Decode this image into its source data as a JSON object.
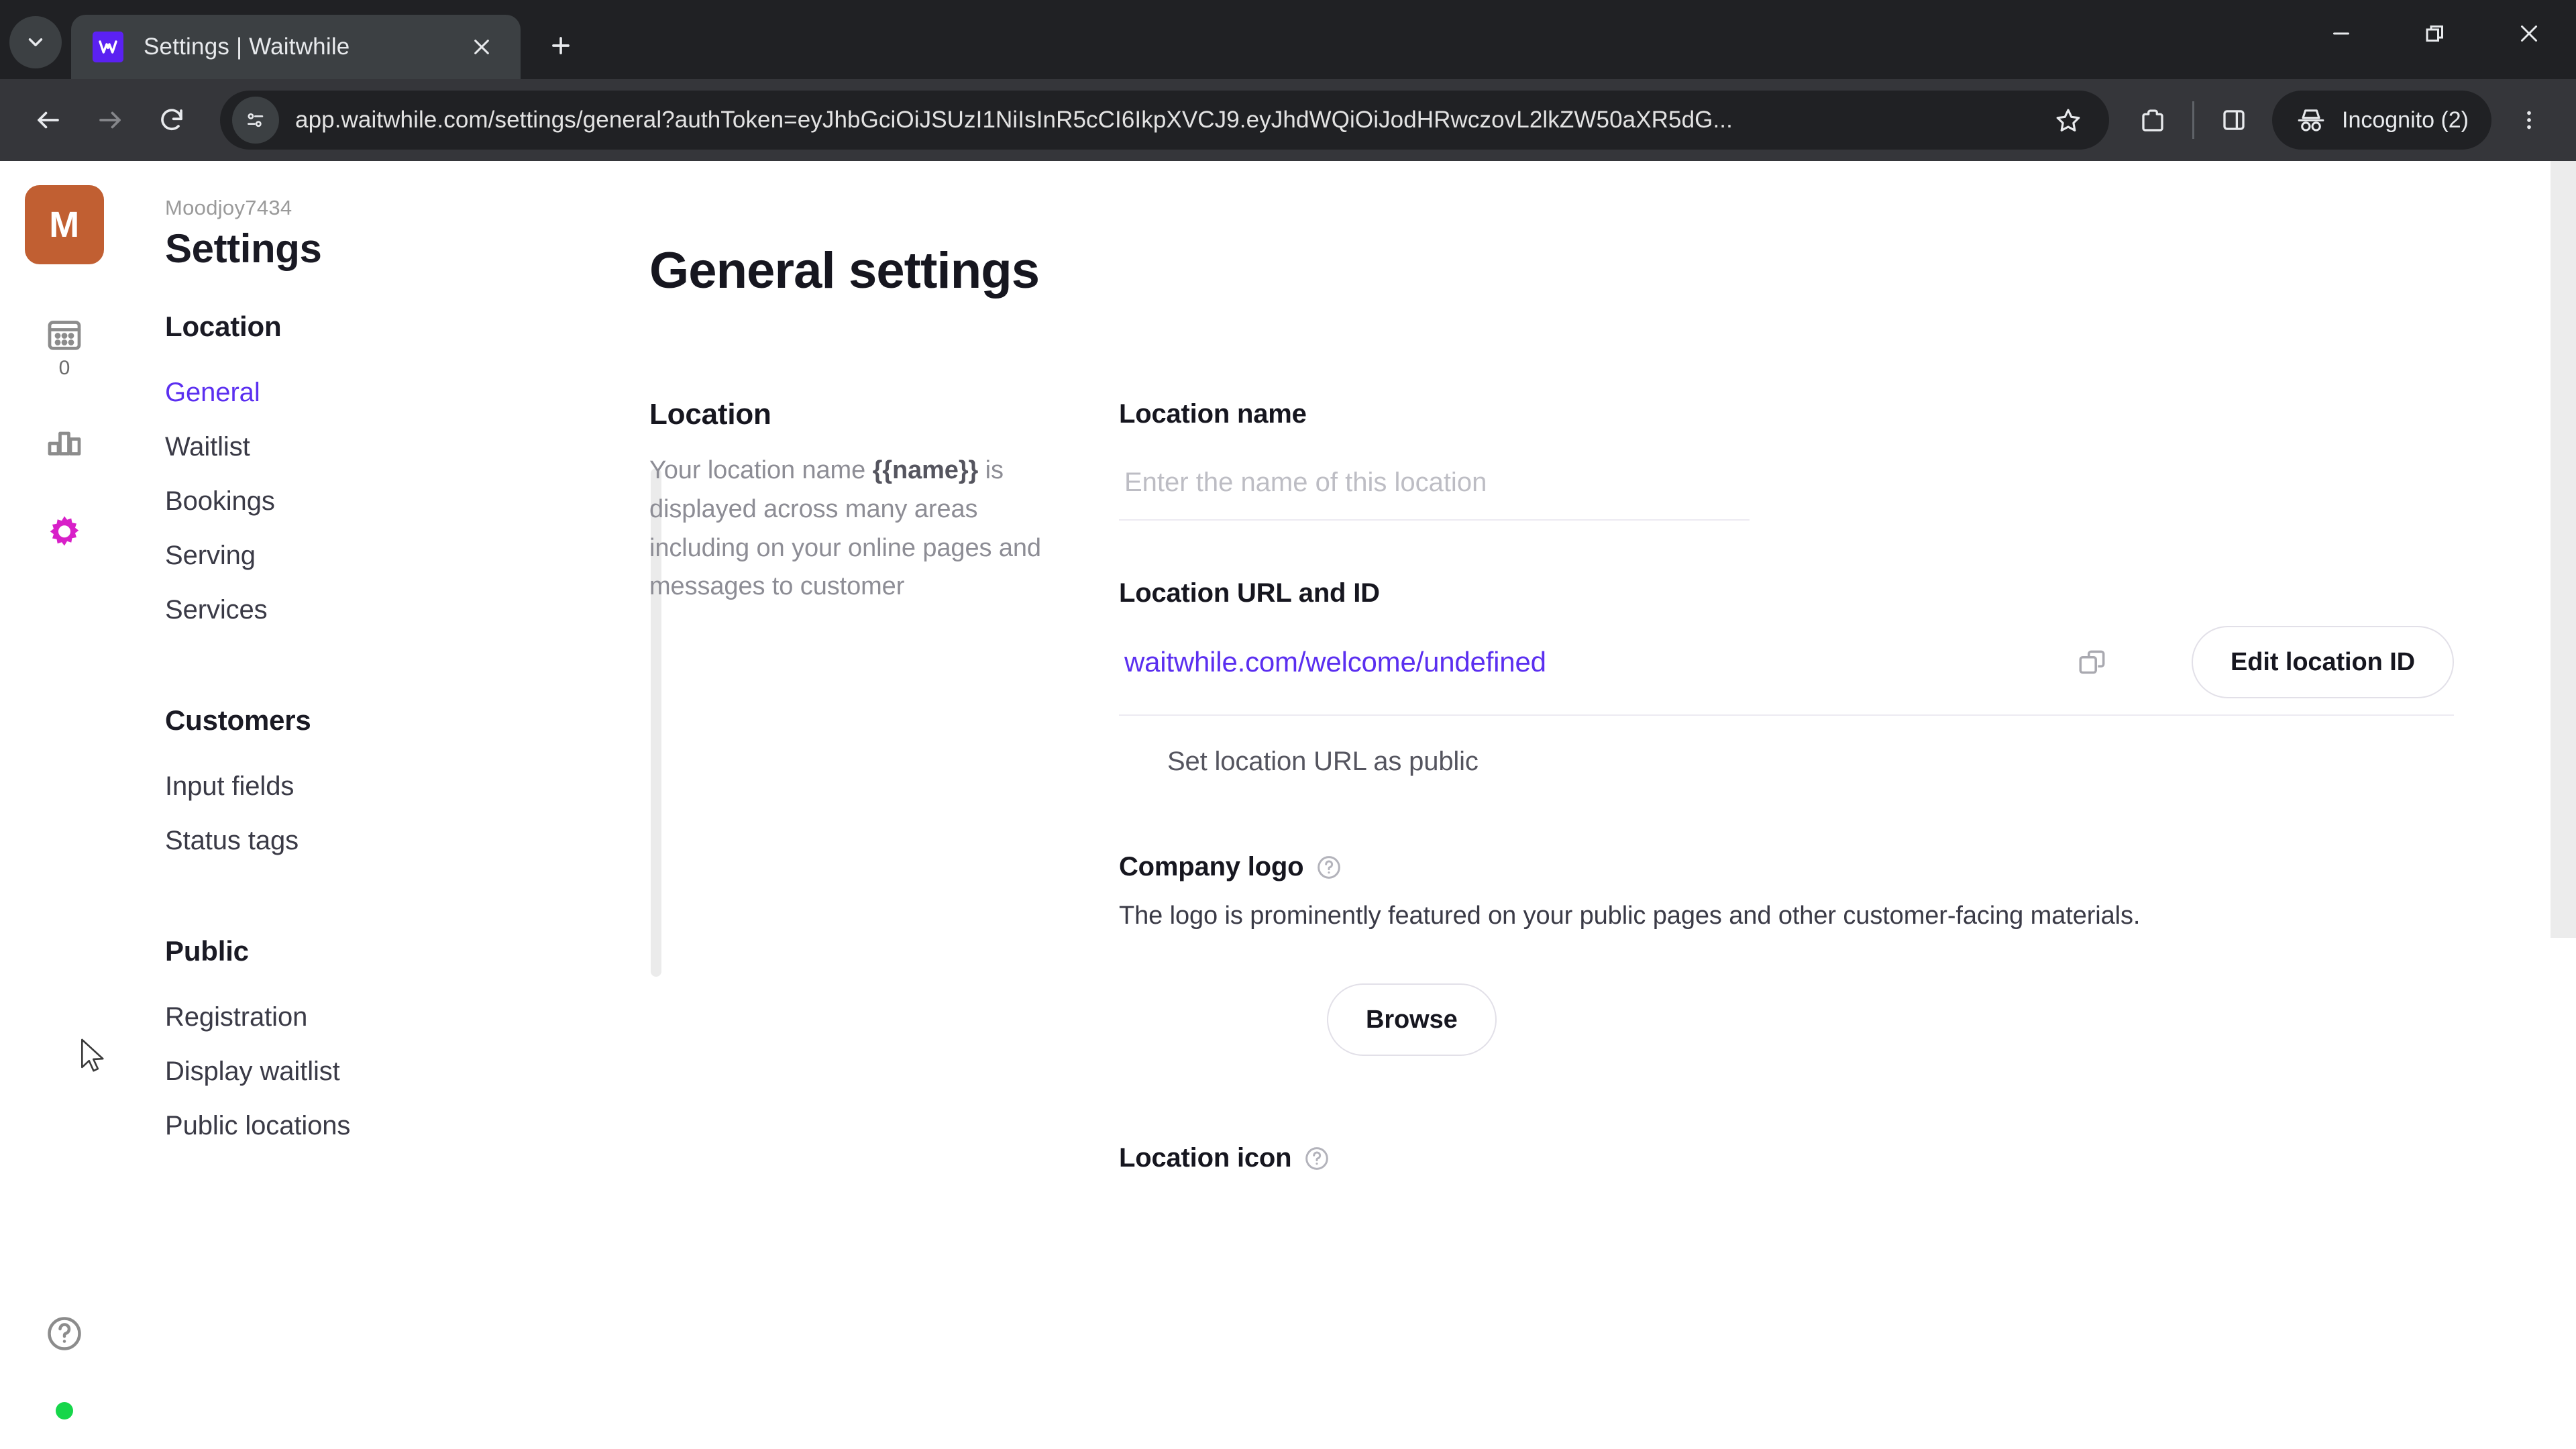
{
  "browser": {
    "tab": {
      "title": "Settings | Waitwhile",
      "favicon_name": "waitwhile-favicon",
      "close_icon": "close-icon"
    },
    "tab_search_icon": "tab-search-chevron-icon",
    "new_tab_icon": "plus-icon",
    "window_controls": {
      "minimize": "minimize-icon",
      "maximize": "restore-icon",
      "close": "close-icon"
    },
    "toolbar": {
      "back_icon": "back-arrow-icon",
      "forward_icon": "forward-arrow-icon",
      "reload_icon": "reload-icon",
      "site_info_icon": "page-info-icon",
      "url": "app.waitwhile.com/settings/general?authToken=eyJhbGciOiJSUzI1NiIsInR5cCI6IkpXVCJ9.eyJhdWQiOiJodHRwczovL2lkZW50aXR5dG...",
      "bookmark_icon": "star-icon",
      "extensions_icon": "extensions-puzzle-icon",
      "side_panel_icon": "side-panel-icon",
      "incognito_icon": "incognito-hat-icon",
      "incognito_label": "Incognito (2)",
      "menu_icon": "three-dot-menu-icon"
    }
  },
  "rail": {
    "logo_letter": "M",
    "items": [
      {
        "icon": "calendar-icon",
        "count": "0"
      },
      {
        "icon": "bar-chart-icon",
        "count": ""
      },
      {
        "icon": "settings-gear-icon",
        "count": ""
      }
    ],
    "help_icon": "help-circle-icon",
    "status_dot_color": "#16d64a"
  },
  "nav": {
    "org": "Moodjoy7434",
    "title": "Settings",
    "groups": [
      {
        "title": "Location",
        "items": [
          {
            "label": "General",
            "active": true
          },
          {
            "label": "Waitlist",
            "active": false
          },
          {
            "label": "Bookings",
            "active": false
          },
          {
            "label": "Serving",
            "active": false
          },
          {
            "label": "Services",
            "active": false
          }
        ]
      },
      {
        "title": "Customers",
        "items": [
          {
            "label": "Input fields",
            "active": false
          },
          {
            "label": "Status tags",
            "active": false
          }
        ]
      },
      {
        "title": "Public",
        "items": [
          {
            "label": "Registration",
            "active": false
          },
          {
            "label": "Display waitlist",
            "active": false
          },
          {
            "label": "Public locations",
            "active": false
          }
        ]
      }
    ]
  },
  "main": {
    "page_title": "General settings",
    "location_section": {
      "heading": "Location",
      "description_pre": "Your location name ",
      "description_token": "{{name}}",
      "description_post": " is displayed across many areas including on your online pages and messages to customer"
    },
    "location_name": {
      "label": "Location name",
      "value": "",
      "placeholder": "Enter the name of this location"
    },
    "location_url": {
      "label": "Location URL and ID",
      "value": "waitwhile.com/welcome/undefined",
      "copy_icon": "copy-icon",
      "edit_button": "Edit location ID",
      "public_checkbox_label": "Set location URL as public"
    },
    "company_logo": {
      "label": "Company logo",
      "help_icon": "help-circle-icon",
      "description": "The logo is prominently featured on your public pages and other customer-facing materials.",
      "browse_button": "Browse"
    },
    "location_icon": {
      "label": "Location icon",
      "help_icon": "help-circle-icon"
    }
  },
  "colors": {
    "accent": "#5b2ff0",
    "logo_bg": "#c15f32",
    "gear_active": "#d820c8",
    "status_green": "#16d64a"
  }
}
